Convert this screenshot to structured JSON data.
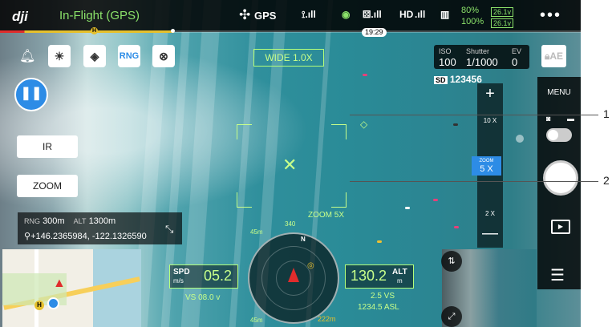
{
  "topbar": {
    "logo": "dji",
    "status": "In-Flight (GPS)",
    "gps_label": "GPS",
    "hd_label": "HD",
    "battery_top": "80%",
    "battery_bottom": "100%",
    "voltage_top": "26.1v",
    "voltage_bottom": "26.1v",
    "time": "19:29",
    "battery_progress": 0.3
  },
  "toolbar": {
    "rng_label": "RNG"
  },
  "left_buttons": {
    "ir_label": "IR",
    "zoom_label": "ZOOM"
  },
  "camera": {
    "mode": "WIDE 1.0X",
    "zoom_overlay": "ZOOM 5X",
    "iso_label": "ISO",
    "iso_value": "100",
    "shutter_label": "Shutter",
    "shutter_value": "1/1000",
    "ev_label": "EV",
    "ev_value": "0",
    "ae_label": "AE",
    "sd_value": "123456"
  },
  "zoom_rail": {
    "top_tick": "10 X",
    "current_label": "ZOOM",
    "current_value": "5 X",
    "bottom_tick": "2 X"
  },
  "rightbar": {
    "menu_label": "MENU"
  },
  "info": {
    "rng_label": "RNG",
    "rng_value": "300m",
    "alt_label": "ALT",
    "alt_value": "1300m",
    "coords": "+146.2365984, -122.1326590"
  },
  "telemetry": {
    "spd_label": "SPD",
    "spd_unit": "m/s",
    "spd_value": "05.2",
    "spd_sub": "VS 08.0 v",
    "alt_label": "ALT",
    "alt_unit": "m",
    "alt_value": "130.2",
    "alt_sub1": "2.5 VS",
    "alt_sub2": "1234.5 ASL"
  },
  "radar": {
    "top_label": "340",
    "left_top": "45m",
    "left_bottom": "45m",
    "bottom_right": "222m"
  },
  "callouts": {
    "one": "1",
    "two": "2"
  },
  "colors": {
    "accent_green": "#b5ff7a",
    "accent_blue": "#2d8ce6",
    "status_green": "#8be26a"
  }
}
